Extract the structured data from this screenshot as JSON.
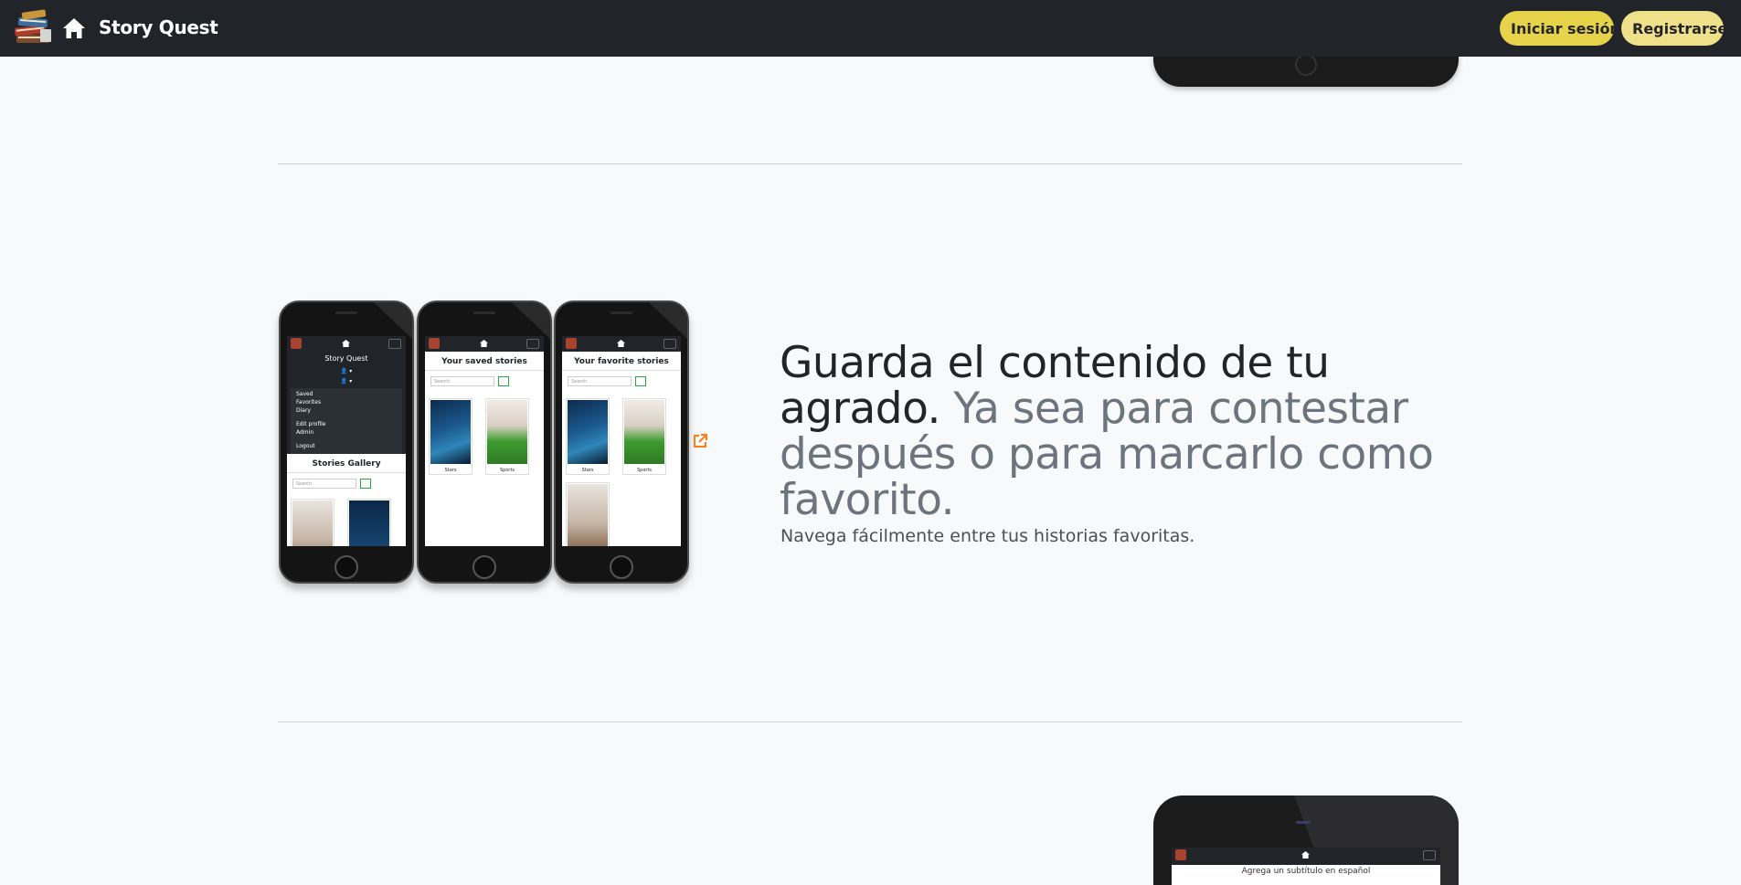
{
  "navbar": {
    "brand": "Story Quest",
    "login_label": "Iniciar sesión",
    "register_label": "Registrarse",
    "icons": [
      "books-logo-icon",
      "home-icon"
    ]
  },
  "feature": {
    "heading_strong": "Guarda el contenido de tu agrado.",
    "heading_muted": "Ya sea para contestar después o para marcarlo como favorito.",
    "lead": "Navega fácilmente entre tus historias favoritas.",
    "link_icon": "external-link-icon"
  },
  "phones": {
    "menu": {
      "brand": "Story Quest",
      "user_1": "▾",
      "user_2": "▾",
      "items": [
        "Saved",
        "Favorites",
        "Diary",
        "Edit profile",
        "Admin",
        "Logout"
      ],
      "gallery_title": "Stories Gallery",
      "search_placeholder": "Search"
    },
    "saved": {
      "title": "Your saved stories",
      "search_placeholder": "Search",
      "cards": [
        "Stars",
        "Sports"
      ]
    },
    "favorites": {
      "title": "Your favorite stories",
      "search_placeholder": "Search",
      "cards": [
        "Stars",
        "Sports"
      ]
    }
  },
  "next_section": {
    "subtitle": "Agrega un subtítulo en español"
  },
  "colors": {
    "navbar_bg": "#212529",
    "login_bg": "#e6d34a",
    "register_bg": "#efe18a",
    "heading_muted": "#6c757d",
    "link_icon": "#fd7e14"
  }
}
